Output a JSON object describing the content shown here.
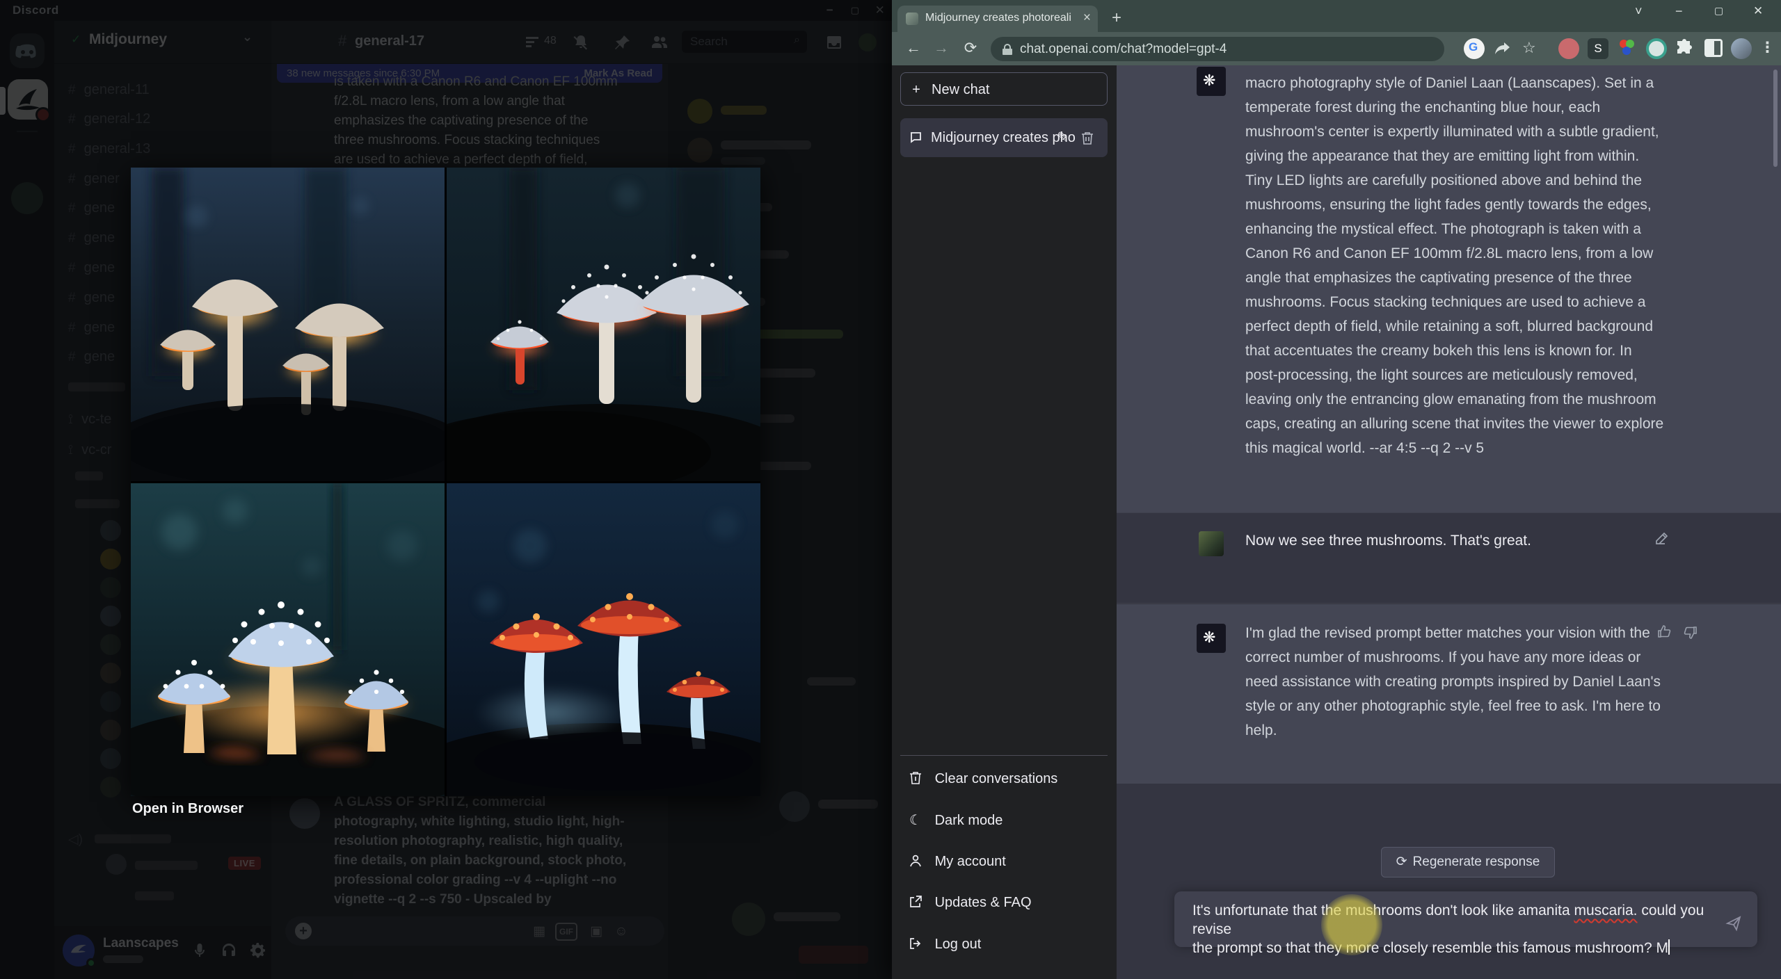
{
  "discord": {
    "window_title": "Discord",
    "window_controls": {
      "minimize": "−",
      "maximize": "▢",
      "close": "✕"
    },
    "server_header": {
      "name": "Midjourney",
      "verified_check": "✓",
      "chevron": "⌄"
    },
    "channel_header": {
      "hash": "#",
      "channel": "general-17",
      "thread_count": "48",
      "search_placeholder": "Search"
    },
    "channels": [
      {
        "label": "general-11"
      },
      {
        "label": "general-12"
      },
      {
        "label": "general-13"
      },
      {
        "label": "gener"
      },
      {
        "label": "gene"
      },
      {
        "label": "gene"
      },
      {
        "label": "gene"
      },
      {
        "label": "gene"
      },
      {
        "label": "gene"
      },
      {
        "label": "gene"
      },
      {
        "label": "vc-te"
      },
      {
        "label": "vc-cr"
      }
    ],
    "new_messages_bar": {
      "text": "38 new messages since 6:30 PM",
      "action": "Mark As Read"
    },
    "top_message": "is taken with a Canon R6 and Canon EF 100mm\nf/2.8L macro lens, from a low angle that\nemphasizes the captivating presence of the\nthree mushrooms. Focus stacking techniques\nare used to achieve a perfect depth of field,",
    "bottom_message": "A GLASS OF SPRITZ, commercial\nphotography, white lighting, studio light, high-\nresolution photography, realistic, high quality,\nfine details, on plain background, stock photo,\nprofessional color grading --v 4 --uplight --no\nvignette --q 2 --s 750 - Upscaled by",
    "live_badge": "LIVE",
    "lightbox_action": "Open in Browser",
    "user_panel": {
      "username": "Laanscapes"
    },
    "input_icons": {
      "gif_label": "GIF"
    }
  },
  "browser": {
    "tab_title": "Midjourney creates photorealisti",
    "tab_close": "×",
    "new_tab": "+",
    "url": "chat.openai.com/chat?model=gpt-4",
    "ext_s_label": "S",
    "window_controls": {
      "search": "˅",
      "minimize": "−",
      "maximize": "▢",
      "close": "✕"
    },
    "nav": {
      "back": "←",
      "forward": "→",
      "reload": "⟳",
      "menu": "⋮"
    }
  },
  "chatgpt": {
    "sidebar": {
      "new_chat": "New chat",
      "conversation_title": "Midjourney creates pho",
      "menu": [
        {
          "label": "Clear conversations"
        },
        {
          "label": "Dark mode"
        },
        {
          "label": "My account"
        },
        {
          "label": "Updates & FAQ"
        },
        {
          "label": "Log out"
        }
      ]
    },
    "assistant_message_1": "macro photography style of Daniel Laan (Laanscapes). Set in a\ntemperate forest during the enchanting blue hour, each\nmushroom's center is expertly illuminated with a subtle gradient,\ngiving the appearance that they are emitting light from within.\nTiny LED lights are carefully positioned above and behind the\nmushrooms, ensuring the light fades gently towards the edges,\nenhancing the mystical effect. The photograph is taken with a\nCanon R6 and Canon EF 100mm f/2.8L macro lens, from a low\nangle that emphasizes the captivating presence of the three\nmushrooms. Focus stacking techniques are used to achieve a\nperfect depth of field, while retaining a soft, blurred background\nthat accentuates the creamy bokeh this lens is known for. In\npost-processing, the light sources are meticulously removed,\nleaving only the entrancing glow emanating from the mushroom\ncaps, creating an alluring scene that invites the viewer to explore\nthis magical world. --ar 4:5 --q 2 --v 5",
    "user_message": "Now we see three mushrooms. That's great.",
    "assistant_message_2": "I'm glad the revised prompt better matches your vision with the\ncorrect number of mushrooms. If you have any more ideas or\nneed assistance with creating prompts inspired by Daniel Laan's\nstyle or any other photographic style, feel free to ask. I'm here to\nhelp.",
    "regenerate_label": "Regenerate response",
    "input": {
      "line1_before": "It's unfortunate that the mushrooms don't look like amanita ",
      "line1_misspelled": "muscaria.",
      "line1_after": " could you revise",
      "line2": "the prompt so that they more closely resemble this famous mushroom? M"
    }
  },
  "colors": {
    "discord_blurple": "#4752c4",
    "chatgpt_row": "#444654",
    "chatgpt_bg": "#343541",
    "chatgpt_sidebar": "#202123",
    "browser_chrome": "#4c5b58",
    "live_red": "#9f3a38"
  }
}
